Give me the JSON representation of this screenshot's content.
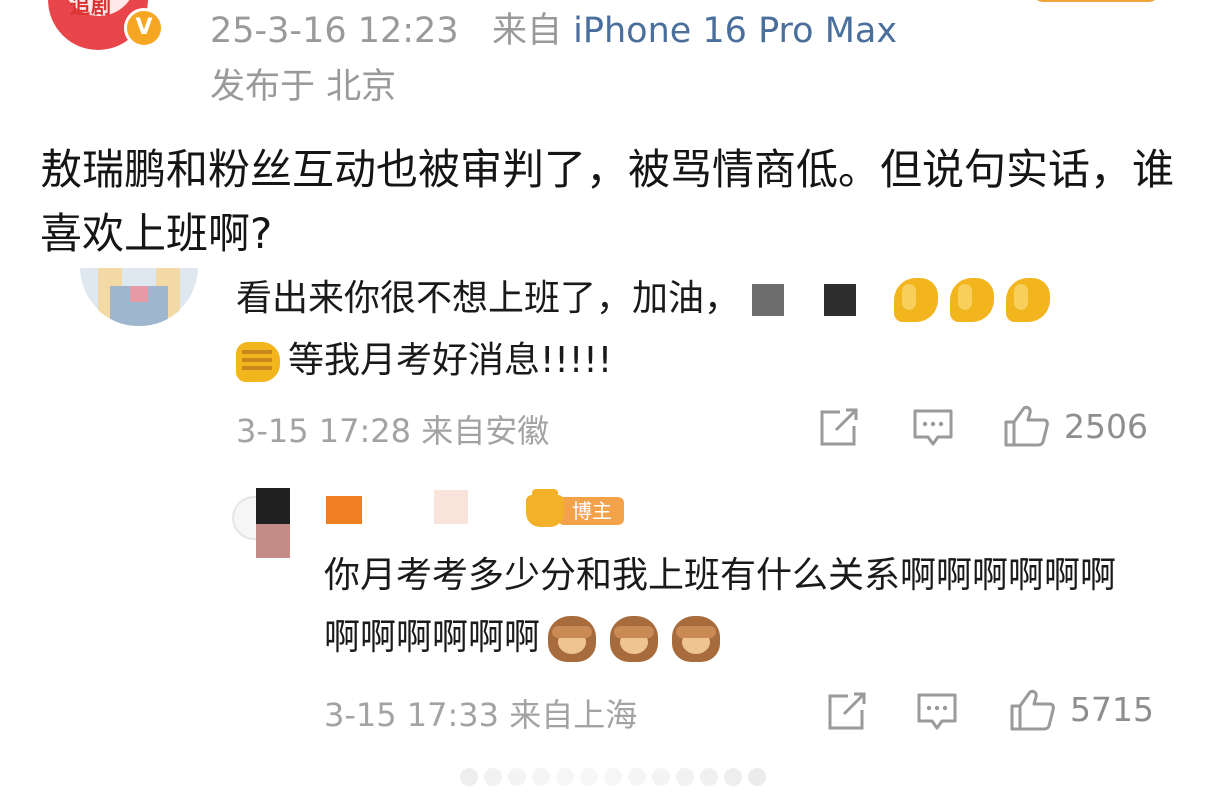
{
  "post": {
    "timestamp": "25-3-16 12:23",
    "source_prefix": "来自",
    "device": "iPhone 16 Pro Max",
    "location": "发布于 北京",
    "avatar_text": "追剧",
    "verified": "V",
    "text": "敖瑞鹏和粉丝互动也被审判了，被骂情商低。但说句实话，谁喜欢上班啊?"
  },
  "comments": [
    {
      "text_part1": "看出来你很不想上班了，加油，",
      "text_part2": "等我月考好消息!!!!!",
      "time": "3-15 17:28",
      "location": "来自安徽",
      "likes": "2506",
      "reply": {
        "badge": "博主",
        "text": "你月考考多少分和我上班有什么关系啊啊啊啊啊啊啊啊啊啊啊啊",
        "time": "3-15 17:33",
        "location": "来自上海",
        "likes": "5715"
      }
    }
  ],
  "icons": [
    "verified-icon",
    "share-icon",
    "comment-icon",
    "like-icon",
    "muscle-emoji",
    "fist-emoji",
    "see-no-evil-monkey-emoji"
  ],
  "colors": {
    "link_blue": "#4a6f9c",
    "meta_gray": "#9a9a9a",
    "badge_orange": "#f4a24a",
    "verified_orange": "#f5a623"
  }
}
